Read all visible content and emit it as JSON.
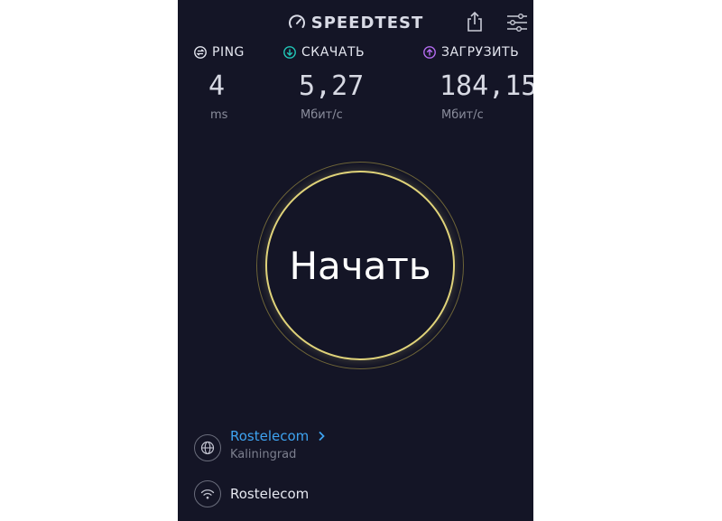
{
  "header": {
    "brand": "SPEEDTEST",
    "brand_icon": "speedometer-icon",
    "share_icon": "share-icon",
    "settings_icon": "settings-sliders-icon"
  },
  "metrics": {
    "ping": {
      "label": "PING",
      "value": "4",
      "unit": "ms",
      "icon": "ping-icon",
      "color": "#e4e6ef"
    },
    "download": {
      "label": "СКАЧАТЬ",
      "value": "5,27",
      "unit": "Мбит/с",
      "icon": "download-arrow-icon",
      "color": "#22c7b8"
    },
    "upload": {
      "label": "ЗАГРУЗИТЬ",
      "value": "184,15",
      "unit": "Мбит/с",
      "icon": "upload-arrow-icon",
      "color": "#b46cf0"
    }
  },
  "start": {
    "label": "Начать",
    "ring_color": "#e0d37a"
  },
  "server": {
    "name": "Rostelecom",
    "location": "Kaliningrad",
    "icon": "globe-icon",
    "chevron": "chevron-right-icon",
    "color": "#3ea3f0"
  },
  "connection": {
    "name": "Rostelecom",
    "icon": "wifi-icon"
  },
  "colors": {
    "background": "#141526"
  }
}
